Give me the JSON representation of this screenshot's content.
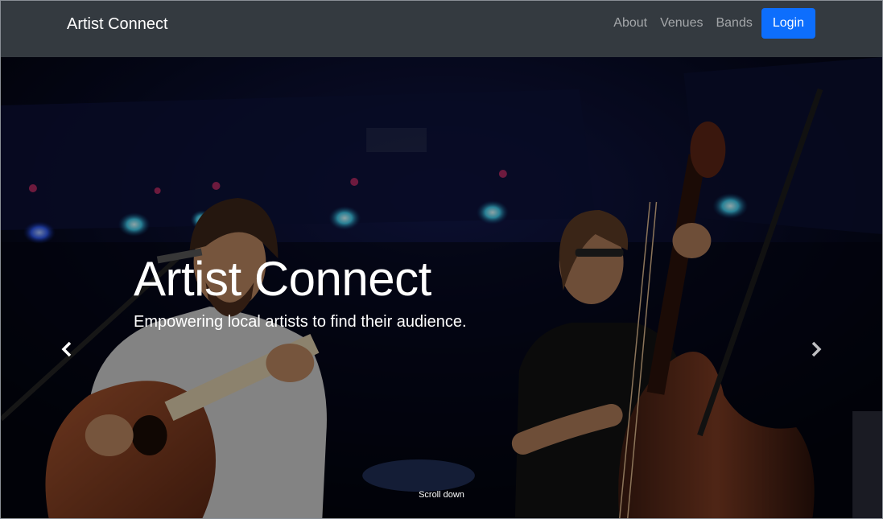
{
  "navbar": {
    "brand": "Artist Connect",
    "links": [
      {
        "label": "About"
      },
      {
        "label": "Venues"
      },
      {
        "label": "Bands"
      }
    ],
    "login_label": "Login"
  },
  "hero": {
    "title": "Artist Connect",
    "subtitle": "Empowering local artists to find their audience.",
    "prev_icon": "chevron-left-icon",
    "next_icon": "chevron-right-icon",
    "scroll_hint": "Scroll down"
  },
  "colors": {
    "navbar_bg": "#343a40",
    "primary_button": "#0d6efd",
    "nav_link": "#9a9da0"
  }
}
